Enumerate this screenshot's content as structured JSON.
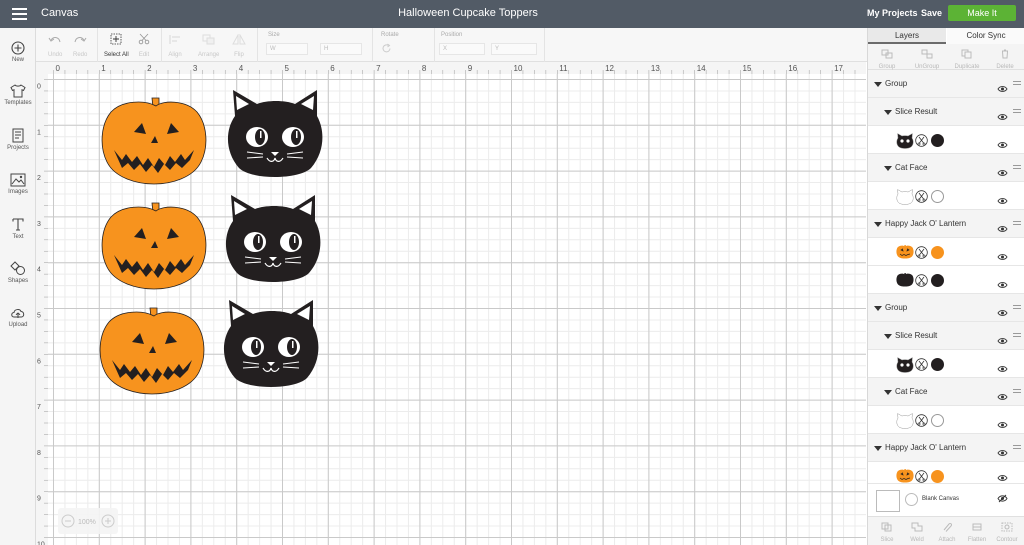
{
  "topbar": {
    "app_title": "Canvas",
    "document_title": "Halloween Cupcake Toppers",
    "my_projects": "My Projects",
    "save": "Save",
    "make_it": "Make It",
    "make_it_color": "#5cb335",
    "bar_color": "#525b66"
  },
  "leftbar": {
    "items": [
      {
        "label": "New",
        "icon": "plus-circle-icon"
      },
      {
        "label": "Templates",
        "icon": "tshirt-icon"
      },
      {
        "label": "Projects",
        "icon": "projects-icon"
      },
      {
        "label": "Images",
        "icon": "image-icon"
      },
      {
        "label": "Text",
        "icon": "text-icon"
      },
      {
        "label": "Shapes",
        "icon": "shapes-icon"
      },
      {
        "label": "Upload",
        "icon": "upload-cloud-icon"
      }
    ]
  },
  "toolbar": {
    "undo": "Undo",
    "redo": "Redo",
    "select_all": "Select All",
    "edit": "Edit",
    "align": "Align",
    "arrange": "Arrange",
    "flip": "Flip",
    "size_label": "Size",
    "size_w": "W",
    "size_h": "H",
    "rotate_label": "Rotate",
    "position_label": "Position",
    "position_x": "X",
    "position_y": "Y"
  },
  "canvas": {
    "zoom": "100%",
    "ruler_top": [
      "0",
      "1",
      "2",
      "3",
      "4",
      "5",
      "6",
      "7",
      "8",
      "9",
      "10",
      "11",
      "12",
      "13",
      "14",
      "15",
      "16",
      "17"
    ],
    "ruler_left": [
      "0",
      "1",
      "2",
      "3",
      "4",
      "5",
      "6",
      "7",
      "8",
      "9",
      "10"
    ],
    "pumpkin_color": "#f7931e",
    "cat_color": "#231f20"
  },
  "panel": {
    "tabs": [
      "Layers",
      "Color Sync"
    ],
    "actions": [
      "Group",
      "UnGroup",
      "Duplicate",
      "Delete"
    ],
    "layers": [
      {
        "name": "Group"
      },
      {
        "name": "Slice Result"
      },
      {
        "name": "Cat Face"
      },
      {
        "name": "Happy Jack O' Lantern"
      },
      {
        "name": "Group"
      },
      {
        "name": "Slice Result"
      },
      {
        "name": "Cat Face"
      },
      {
        "name": "Happy Jack O' Lantern"
      }
    ],
    "blank_canvas": "Blank Canvas",
    "bottom_actions": [
      "Slice",
      "Weld",
      "Attach",
      "Flatten",
      "Contour"
    ]
  }
}
